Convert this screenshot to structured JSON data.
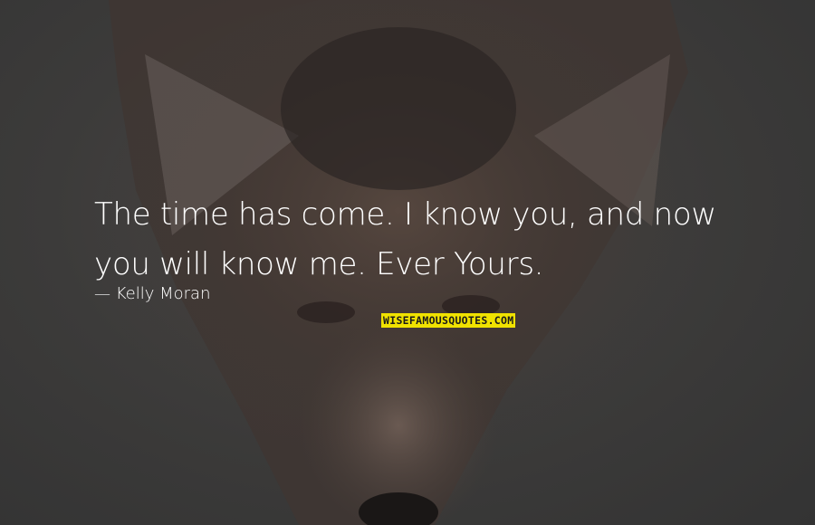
{
  "quote": {
    "line1": "The time has come. I know you, and now",
    "line2": "you will know me. Ever Yours."
  },
  "author": "Kelly Moran",
  "watermark": "WISEFAMOUSQUOTES.COM",
  "background": {
    "subject": "coyote face, dimmed",
    "colors": {
      "fur_dark": "#2b2523",
      "fur_mid": "#5a4a40",
      "fur_light": "#8a7a70",
      "backdrop": "#3a3a3a"
    }
  },
  "colors": {
    "text": "#ffffff",
    "watermark_bg": "#f0e200",
    "watermark_text": "#1a1a1a"
  }
}
